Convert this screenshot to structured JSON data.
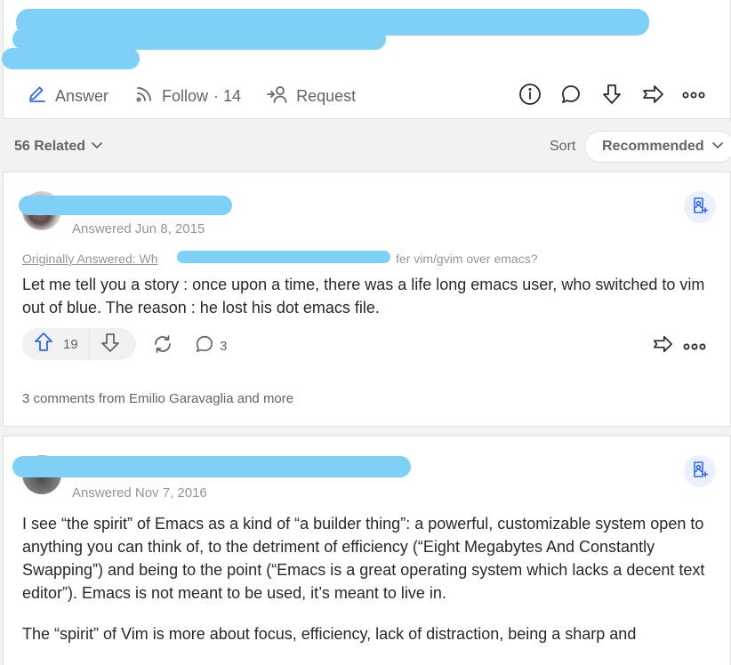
{
  "question": {
    "actions": {
      "answer_label": "Answer",
      "follow_label": "Follow",
      "follow_count": "· 14",
      "request_label": "Request"
    }
  },
  "related": {
    "label": "56 Related",
    "sort_label": "Sort",
    "sort_value": "Recommended"
  },
  "answers": [
    {
      "answered": "Answered Jun 8, 2015",
      "originally_answered_prefix": "Originally Answered: Wh",
      "originally_answered_tail": "fer vim/gvim over emacs?",
      "paragraphs": [
        "Let me tell you a story : once upon a time, there was a life long emacs user, who switched to vim out of blue. The reason : he lost his dot emacs file."
      ],
      "upvotes": "19",
      "comment_count": "3",
      "comments_summary": "3 comments from Emilio Garavaglia and more"
    },
    {
      "answered": "Answered Nov 7, 2016",
      "paragraphs": [
        "I see “the spirit” of Emacs as a kind of “a builder thing”: a powerful, customizable system open to anything you can think of, to the detriment of efficiency (“Eight Megabytes And Constantly Swapping”) and being to the point (“Emacs is a great operating system which lacks a decent text editor”). Emacs is not meant to be used, it’s meant to live in.",
        "The “spirit” of Vim is more about focus, efficiency, lack of distraction, being a sharp and"
      ]
    }
  ],
  "icons": {
    "answer": "pencil-icon",
    "follow": "rss-icon",
    "request": "person-add-icon",
    "info": "info-icon",
    "comment": "speech-bubble-icon",
    "downvote": "arrow-down-icon",
    "share": "share-arrow-icon",
    "more": "more-dots-icon",
    "bookmark": "bookmark-person-icon",
    "reshare": "refresh-icon"
  },
  "colors": {
    "accent": "#2e69ff",
    "redaction": "#7ed0f7",
    "muted": "#636466"
  }
}
